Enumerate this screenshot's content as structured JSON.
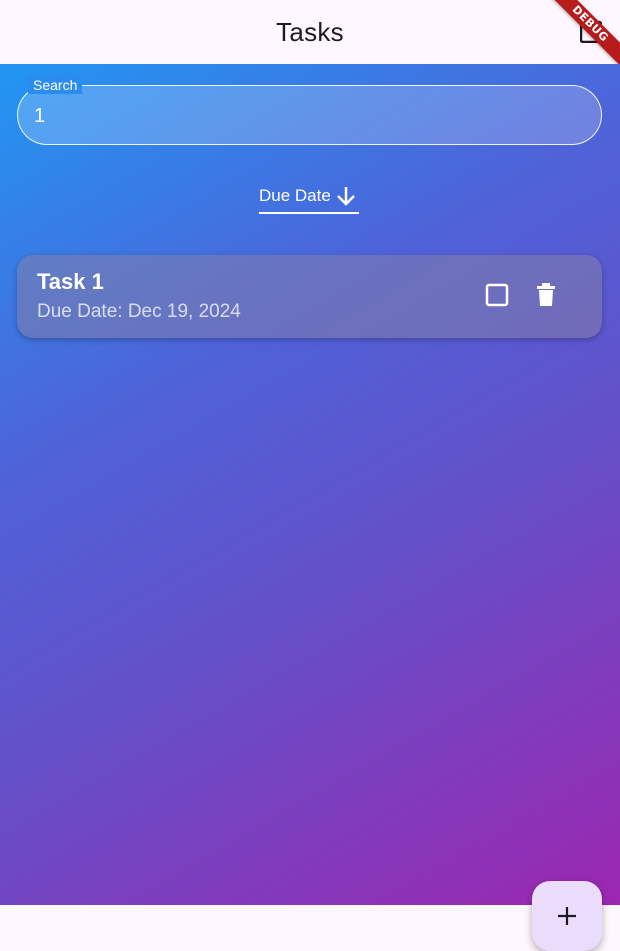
{
  "appbar": {
    "title": "Tasks",
    "action_icon": "calendar-icon"
  },
  "debug_banner": {
    "label": "DEBUG",
    "color": "#b71c1c"
  },
  "search": {
    "label": "Search",
    "value": "1"
  },
  "sort": {
    "label": "Due Date",
    "direction_icon": "arrow-down-icon"
  },
  "tasks": [
    {
      "title": "Task 1",
      "due": "Due Date: Dec 19, 2024",
      "completed": false
    }
  ],
  "fab": {
    "icon": "plus-icon"
  },
  "colors": {
    "gradient_start": "#2196f3",
    "gradient_end": "#9c27b0",
    "appbar_bg": "#fef7ff",
    "fab_bg": "#eadcfb"
  }
}
